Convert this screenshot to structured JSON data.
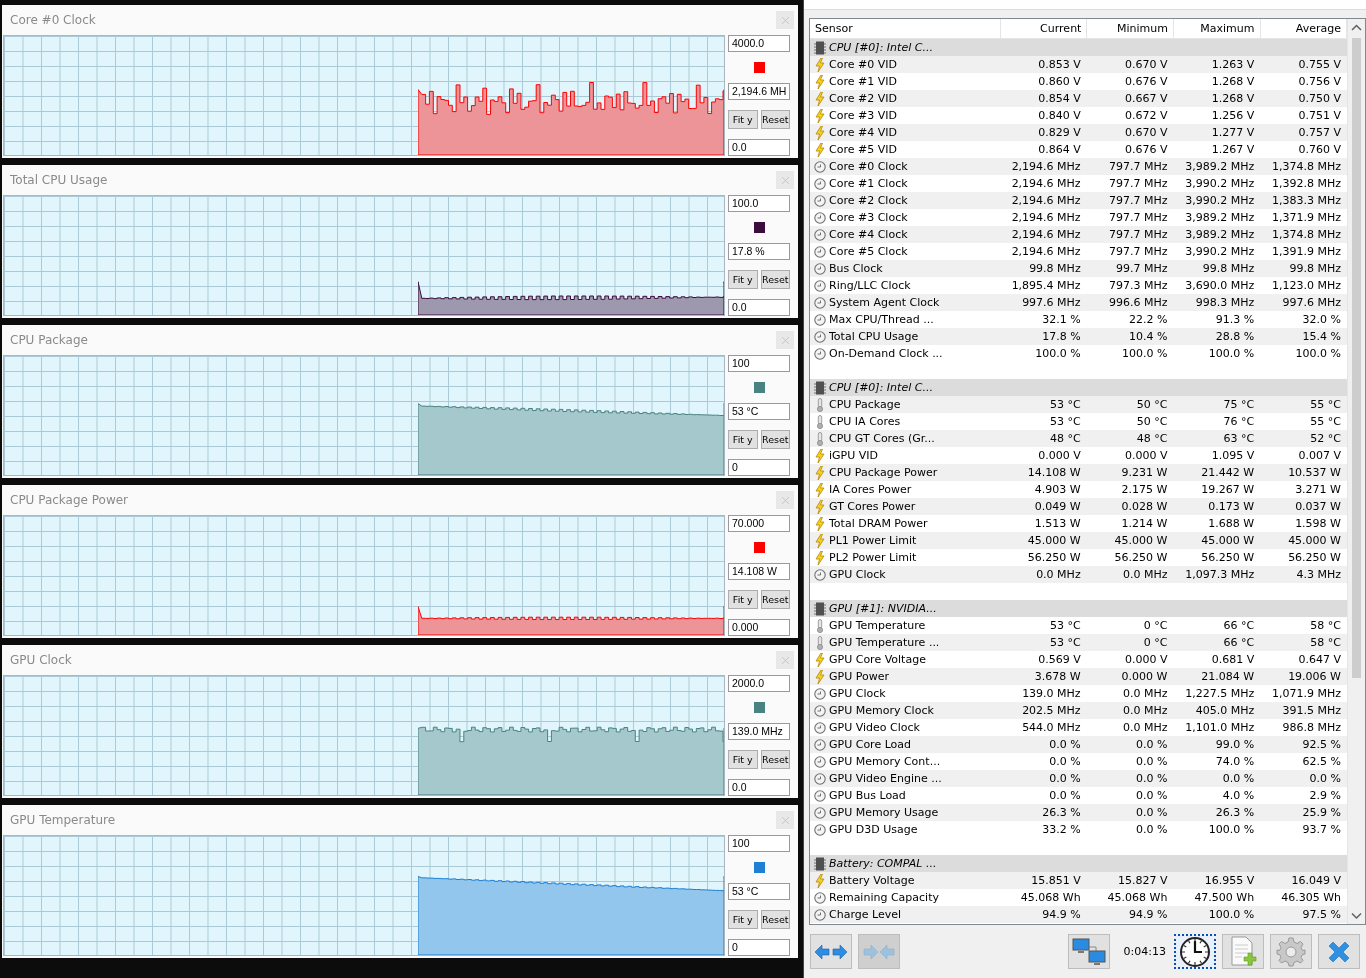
{
  "graphs": [
    {
      "title": "Core #0 Clock",
      "max": "4000.0",
      "color": "#ff0000",
      "current": "2,194.6 MH",
      "min": "0.0",
      "fit_button": "Fit y",
      "reset_button": "Reset"
    },
    {
      "title": "Total CPU Usage",
      "max": "100.0",
      "color": "#3c0c3c",
      "current": "17.8 %",
      "min": "0.0",
      "fit_button": "Fit y",
      "reset_button": "Reset"
    },
    {
      "title": "CPU Package",
      "max": "100",
      "color": "#4a8282",
      "current": "53 °C",
      "min": "0",
      "fit_button": "Fit y",
      "reset_button": "Reset"
    },
    {
      "title": "CPU Package Power",
      "max": "70.000",
      "color": "#ff0000",
      "current": "14.108 W",
      "min": "0.000",
      "fit_button": "Fit y",
      "reset_button": "Reset"
    },
    {
      "title": "GPU Clock",
      "max": "2000.0",
      "color": "#4a8282",
      "current": "139.0 MHz",
      "min": "0.0",
      "fit_button": "Fit y",
      "reset_button": "Reset"
    },
    {
      "title": "GPU Temperature",
      "max": "100",
      "color": "#1e7fd4",
      "current": "53 °C",
      "min": "0",
      "fit_button": "Fit y",
      "reset_button": "Reset"
    }
  ],
  "sensor_table": {
    "columns": [
      "Sensor",
      "Current",
      "Minimum",
      "Maximum",
      "Average"
    ],
    "rows": [
      {
        "kind": "group",
        "name": "CPU [#0]: Intel C..."
      },
      {
        "kind": "voltage",
        "name": "Core #0 VID",
        "values": [
          "0.853 V",
          "0.670 V",
          "1.263 V",
          "0.755 V"
        ]
      },
      {
        "kind": "voltage",
        "name": "Core #1 VID",
        "values": [
          "0.860 V",
          "0.676 V",
          "1.268 V",
          "0.756 V"
        ]
      },
      {
        "kind": "voltage",
        "name": "Core #2 VID",
        "values": [
          "0.854 V",
          "0.667 V",
          "1.268 V",
          "0.750 V"
        ]
      },
      {
        "kind": "voltage",
        "name": "Core #3 VID",
        "values": [
          "0.840 V",
          "0.672 V",
          "1.256 V",
          "0.751 V"
        ]
      },
      {
        "kind": "voltage",
        "name": "Core #4 VID",
        "values": [
          "0.829 V",
          "0.670 V",
          "1.277 V",
          "0.757 V"
        ]
      },
      {
        "kind": "voltage",
        "name": "Core #5 VID",
        "values": [
          "0.864 V",
          "0.676 V",
          "1.267 V",
          "0.760 V"
        ]
      },
      {
        "kind": "clock",
        "name": "Core #0 Clock",
        "values": [
          "2,194.6 MHz",
          "797.7 MHz",
          "3,989.2 MHz",
          "1,374.8 MHz"
        ]
      },
      {
        "kind": "clock",
        "name": "Core #1 Clock",
        "values": [
          "2,194.6 MHz",
          "797.7 MHz",
          "3,990.2 MHz",
          "1,392.8 MHz"
        ]
      },
      {
        "kind": "clock",
        "name": "Core #2 Clock",
        "values": [
          "2,194.6 MHz",
          "797.7 MHz",
          "3,990.2 MHz",
          "1,383.3 MHz"
        ]
      },
      {
        "kind": "clock",
        "name": "Core #3 Clock",
        "values": [
          "2,194.6 MHz",
          "797.7 MHz",
          "3,989.2 MHz",
          "1,371.9 MHz"
        ]
      },
      {
        "kind": "clock",
        "name": "Core #4 Clock",
        "values": [
          "2,194.6 MHz",
          "797.7 MHz",
          "3,989.2 MHz",
          "1,374.8 MHz"
        ]
      },
      {
        "kind": "clock",
        "name": "Core #5 Clock",
        "values": [
          "2,194.6 MHz",
          "797.7 MHz",
          "3,990.2 MHz",
          "1,391.9 MHz"
        ]
      },
      {
        "kind": "clock",
        "name": "Bus Clock",
        "values": [
          "99.8 MHz",
          "99.7 MHz",
          "99.8 MHz",
          "99.8 MHz"
        ]
      },
      {
        "kind": "clock",
        "name": "Ring/LLC Clock",
        "values": [
          "1,895.4 MHz",
          "797.3 MHz",
          "3,690.0 MHz",
          "1,123.0 MHz"
        ]
      },
      {
        "kind": "clock",
        "name": "System Agent Clock",
        "values": [
          "997.6 MHz",
          "996.6 MHz",
          "998.3 MHz",
          "997.6 MHz"
        ]
      },
      {
        "kind": "clock",
        "name": "Max CPU/Thread ...",
        "values": [
          "32.1 %",
          "22.2 %",
          "91.3 %",
          "32.0 %"
        ]
      },
      {
        "kind": "clock",
        "name": "Total CPU Usage",
        "values": [
          "17.8 %",
          "10.4 %",
          "28.8 %",
          "15.4 %"
        ]
      },
      {
        "kind": "clock",
        "name": "On-Demand Clock ...",
        "values": [
          "100.0 %",
          "100.0 %",
          "100.0 %",
          "100.0 %"
        ]
      },
      {
        "kind": "spacer"
      },
      {
        "kind": "group",
        "name": "CPU [#0]: Intel C..."
      },
      {
        "kind": "temperature",
        "name": "CPU Package",
        "values": [
          "53 °C",
          "50 °C",
          "75 °C",
          "55 °C"
        ]
      },
      {
        "kind": "temperature",
        "name": "CPU IA Cores",
        "values": [
          "53 °C",
          "50 °C",
          "76 °C",
          "55 °C"
        ]
      },
      {
        "kind": "temperature",
        "name": "CPU GT Cores (Gr...",
        "values": [
          "48 °C",
          "48 °C",
          "63 °C",
          "52 °C"
        ]
      },
      {
        "kind": "voltage",
        "name": "iGPU VID",
        "values": [
          "0.000 V",
          "0.000 V",
          "1.095 V",
          "0.007 V"
        ]
      },
      {
        "kind": "voltage",
        "name": "CPU Package Power",
        "values": [
          "14.108 W",
          "9.231 W",
          "21.442 W",
          "10.537 W"
        ]
      },
      {
        "kind": "voltage",
        "name": "IA Cores Power",
        "values": [
          "4.903 W",
          "2.175 W",
          "19.267 W",
          "3.271 W"
        ]
      },
      {
        "kind": "voltage",
        "name": "GT Cores Power",
        "values": [
          "0.049 W",
          "0.028 W",
          "0.173 W",
          "0.037 W"
        ]
      },
      {
        "kind": "voltage",
        "name": "Total DRAM Power",
        "values": [
          "1.513 W",
          "1.214 W",
          "1.688 W",
          "1.598 W"
        ]
      },
      {
        "kind": "voltage",
        "name": "PL1 Power Limit",
        "values": [
          "45.000 W",
          "45.000 W",
          "45.000 W",
          "45.000 W"
        ]
      },
      {
        "kind": "voltage",
        "name": "PL2 Power Limit",
        "values": [
          "56.250 W",
          "56.250 W",
          "56.250 W",
          "56.250 W"
        ]
      },
      {
        "kind": "clock",
        "name": "GPU Clock",
        "values": [
          "0.0 MHz",
          "0.0 MHz",
          "1,097.3 MHz",
          "4.3 MHz"
        ]
      },
      {
        "kind": "spacer"
      },
      {
        "kind": "group",
        "name": "GPU [#1]: NVIDIA..."
      },
      {
        "kind": "temperature",
        "name": "GPU Temperature",
        "values": [
          "53 °C",
          "0 °C",
          "66 °C",
          "58 °C"
        ]
      },
      {
        "kind": "temperature",
        "name": "GPU Temperature ...",
        "values": [
          "53 °C",
          "0 °C",
          "66 °C",
          "58 °C"
        ]
      },
      {
        "kind": "voltage",
        "name": "GPU Core Voltage",
        "values": [
          "0.569 V",
          "0.000 V",
          "0.681 V",
          "0.647 V"
        ]
      },
      {
        "kind": "voltage",
        "name": "GPU Power",
        "values": [
          "3.678 W",
          "0.000 W",
          "21.084 W",
          "19.006 W"
        ]
      },
      {
        "kind": "clock",
        "name": "GPU Clock",
        "values": [
          "139.0 MHz",
          "0.0 MHz",
          "1,227.5 MHz",
          "1,071.9 MHz"
        ]
      },
      {
        "kind": "clock",
        "name": "GPU Memory Clock",
        "values": [
          "202.5 MHz",
          "0.0 MHz",
          "405.0 MHz",
          "391.5 MHz"
        ]
      },
      {
        "kind": "clock",
        "name": "GPU Video Clock",
        "values": [
          "544.0 MHz",
          "0.0 MHz",
          "1,101.0 MHz",
          "986.8 MHz"
        ]
      },
      {
        "kind": "clock",
        "name": "GPU Core Load",
        "values": [
          "0.0 %",
          "0.0 %",
          "99.0 %",
          "92.5 %"
        ]
      },
      {
        "kind": "clock",
        "name": "GPU Memory Cont...",
        "values": [
          "0.0 %",
          "0.0 %",
          "74.0 %",
          "62.5 %"
        ]
      },
      {
        "kind": "clock",
        "name": "GPU Video Engine ...",
        "values": [
          "0.0 %",
          "0.0 %",
          "0.0 %",
          "0.0 %"
        ]
      },
      {
        "kind": "clock",
        "name": "GPU Bus Load",
        "values": [
          "0.0 %",
          "0.0 %",
          "4.0 %",
          "2.9 %"
        ]
      },
      {
        "kind": "clock",
        "name": "GPU Memory Usage",
        "values": [
          "26.3 %",
          "0.0 %",
          "26.3 %",
          "25.9 %"
        ]
      },
      {
        "kind": "clock",
        "name": "GPU D3D Usage",
        "values": [
          "33.2 %",
          "0.0 %",
          "100.0 %",
          "93.7 %"
        ]
      },
      {
        "kind": "spacer"
      },
      {
        "kind": "group",
        "name": "Battery: COMPAL ..."
      },
      {
        "kind": "voltage",
        "name": "Battery Voltage",
        "values": [
          "15.851 V",
          "15.827 V",
          "16.955 V",
          "16.049 V"
        ]
      },
      {
        "kind": "clock",
        "name": "Remaining Capacity",
        "values": [
          "45.068 Wh",
          "45.068 Wh",
          "47.500 Wh",
          "46.305 Wh"
        ]
      },
      {
        "kind": "clock",
        "name": "Charge Level",
        "values": [
          "94.9 %",
          "94.9 %",
          "100.0 %",
          "97.5 %"
        ]
      }
    ]
  },
  "toolbar": {
    "left_buttons": [
      {
        "kind": "expand",
        "disabled": false
      },
      {
        "kind": "collapse",
        "disabled": true
      }
    ],
    "right_buttons": [
      {
        "kind": "network",
        "disabled": false
      }
    ],
    "timer": "0:04:13",
    "end_buttons": [
      {
        "kind": "clock",
        "selected": true,
        "disabled": false
      },
      {
        "kind": "report",
        "selected": false,
        "disabled": false
      },
      {
        "kind": "settings",
        "selected": false,
        "disabled": false
      },
      {
        "kind": "close",
        "selected": false,
        "disabled": false
      }
    ]
  }
}
